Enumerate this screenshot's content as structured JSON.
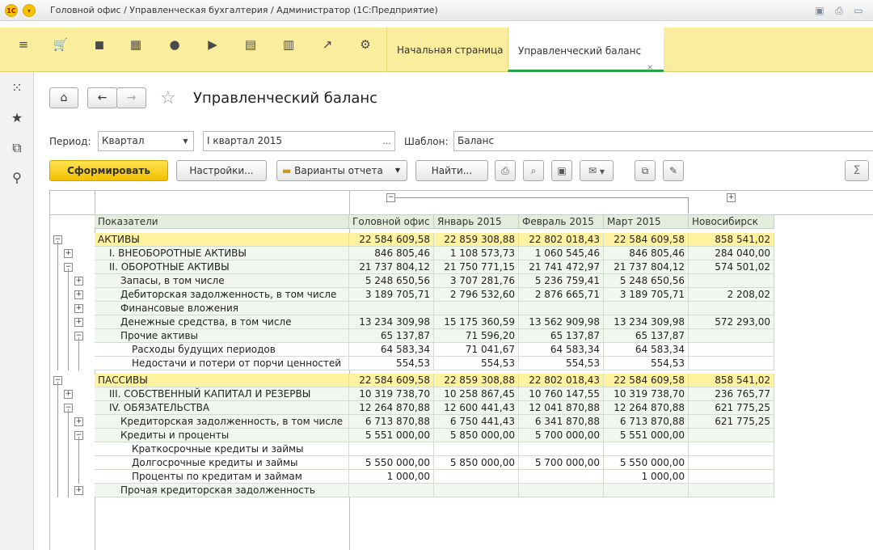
{
  "window": {
    "title": "Головной офис / Управленческая бухгалтерия / Администратор  (1С:Предприятие)"
  },
  "tabs": [
    {
      "label": "Начальная страница"
    },
    {
      "label": "Управленческий баланс"
    }
  ],
  "page": {
    "title": "Управленческий баланс"
  },
  "filters": {
    "period_label": "Период:",
    "period_value": "Квартал",
    "period_range": "I квартал 2015",
    "ellipsis": "...",
    "template_label": "Шаблон:",
    "template_value": "Баланс"
  },
  "buttons": {
    "generate": "Сформировать",
    "settings": "Настройки...",
    "variants": "Варианты отчета",
    "find": "Найти...",
    "sum": "Σ"
  },
  "table": {
    "headers": [
      "Показатели",
      "Головной офис",
      "Январь 2015",
      "Февраль 2015",
      "Март 2015",
      "Новосибирск"
    ],
    "rows": [
      {
        "name": "АКТИВЫ",
        "values": [
          "22 584 609,58",
          "22 859 308,88",
          "22 802 018,43",
          "22 584 609,58",
          "858 541,02"
        ]
      },
      {
        "name": "I. ВНЕОБОРОТНЫЕ АКТИВЫ",
        "values": [
          "846 805,46",
          "1 108 573,73",
          "1 060 545,46",
          "846 805,46",
          "284 040,00"
        ]
      },
      {
        "name": "II. ОБОРОТНЫЕ АКТИВЫ",
        "values": [
          "21 737 804,12",
          "21 750 771,15",
          "21 741 472,97",
          "21 737 804,12",
          "574 501,02"
        ]
      },
      {
        "name": "Запасы, в том числе",
        "values": [
          "5 248 650,56",
          "3 707 281,76",
          "5 236 759,41",
          "5 248 650,56",
          ""
        ]
      },
      {
        "name": "Дебиторская задолженность, в том числе",
        "values": [
          "3 189 705,71",
          "2 796 532,60",
          "2 876 665,71",
          "3 189 705,71",
          "2 208,02"
        ]
      },
      {
        "name": "Финансовые вложения",
        "values": [
          "",
          "",
          "",
          "",
          ""
        ]
      },
      {
        "name": "Денежные средства, в том числе",
        "values": [
          "13 234 309,98",
          "15 175 360,59",
          "13 562 909,98",
          "13 234 309,98",
          "572 293,00"
        ]
      },
      {
        "name": "Прочие активы",
        "values": [
          "65 137,87",
          "71 596,20",
          "65 137,87",
          "65 137,87",
          ""
        ]
      },
      {
        "name": "Расходы будущих периодов",
        "values": [
          "64 583,34",
          "71 041,67",
          "64 583,34",
          "64 583,34",
          ""
        ]
      },
      {
        "name": "Недостачи и потери от порчи ценностей",
        "values": [
          "554,53",
          "554,53",
          "554,53",
          "554,53",
          ""
        ]
      },
      {
        "name": "ПАССИВЫ",
        "values": [
          "22 584 609,58",
          "22 859 308,88",
          "22 802 018,43",
          "22 584 609,58",
          "858 541,02"
        ]
      },
      {
        "name": "III. СОБСТВЕННЫЙ КАПИТАЛ И РЕЗЕРВЫ",
        "values": [
          "10 319 738,70",
          "10 258 867,45",
          "10 760 147,55",
          "10 319 738,70",
          "236 765,77"
        ]
      },
      {
        "name": "IV. ОБЯЗАТЕЛЬСТВА",
        "values": [
          "12 264 870,88",
          "12 600 441,43",
          "12 041 870,88",
          "12 264 870,88",
          "621 775,25"
        ]
      },
      {
        "name": "Кредиторская задолженность, в том числе",
        "values": [
          "6 713 870,88",
          "6 750 441,43",
          "6 341 870,88",
          "6 713 870,88",
          "621 775,25"
        ]
      },
      {
        "name": "Кредиты и проценты",
        "values": [
          "5 551 000,00",
          "5 850 000,00",
          "5 700 000,00",
          "5 551 000,00",
          ""
        ]
      },
      {
        "name": "Краткосрочные кредиты и займы",
        "values": [
          "",
          "",
          "",
          "",
          ""
        ]
      },
      {
        "name": "Долгосрочные кредиты и займы",
        "values": [
          "5 550 000,00",
          "5 850 000,00",
          "5 700 000,00",
          "5 550 000,00",
          ""
        ]
      },
      {
        "name": "Проценты по кредитам и займам",
        "values": [
          "1 000,00",
          "",
          "",
          "1 000,00",
          ""
        ]
      },
      {
        "name": "Прочая кредиторская задолженность",
        "values": [
          "",
          "",
          "",
          "",
          ""
        ]
      }
    ]
  }
}
